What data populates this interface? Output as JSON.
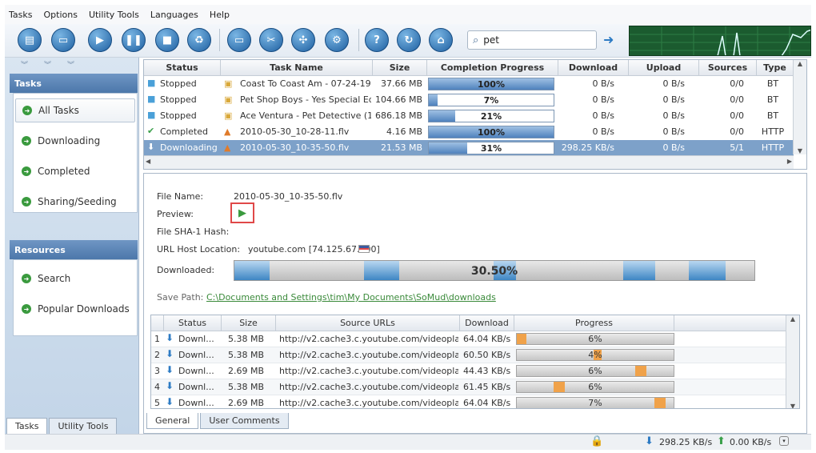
{
  "menu": [
    "Tasks",
    "Options",
    "Utility Tools",
    "Languages",
    "Help"
  ],
  "search": {
    "value": "pet"
  },
  "sidebar": {
    "tasks_header": "Tasks",
    "task_items": [
      "All Tasks",
      "Downloading",
      "Completed",
      "Sharing/Seeding"
    ],
    "resources_header": "Resources",
    "resource_items": [
      "Search",
      "Popular Downloads"
    ],
    "tabs": [
      "Tasks",
      "Utility Tools"
    ]
  },
  "task_table": {
    "columns": [
      "Status",
      "Task Name",
      "Size",
      "Completion Progress",
      "Download",
      "Upload",
      "Sources",
      "Type"
    ],
    "rows": [
      {
        "status": "Stopped",
        "name": "Coast To Coast Am - 07-24-19...",
        "size": "37.66 MB",
        "progress": "100%",
        "pct": 1.0,
        "down": "0 B/s",
        "up": "0 B/s",
        "sources": "0/0",
        "type": "BT"
      },
      {
        "status": "Stopped",
        "name": "Pet Shop Boys - Yes Special Edi...",
        "size": "104.66 MB",
        "progress": "7%",
        "pct": 0.07,
        "down": "0 B/s",
        "up": "0 B/s",
        "sources": "0/0",
        "type": "BT"
      },
      {
        "status": "Stopped",
        "name": "Ace Ventura - Pet Detective (1...",
        "size": "686.18 MB",
        "progress": "21%",
        "pct": 0.21,
        "down": "0 B/s",
        "up": "0 B/s",
        "sources": "0/0",
        "type": "BT"
      },
      {
        "status": "Completed",
        "name": "2010-05-30_10-28-11.flv",
        "size": "4.16 MB",
        "progress": "100%",
        "pct": 1.0,
        "down": "0 B/s",
        "up": "0 B/s",
        "sources": "0/0",
        "type": "HTTP"
      },
      {
        "status": "Downloading",
        "name": "2010-05-30_10-35-50.flv",
        "size": "21.53 MB",
        "progress": "31%",
        "pct": 0.31,
        "down": "298.25 KB/s",
        "up": "0 B/s",
        "sources": "5/1",
        "type": "HTTP"
      }
    ]
  },
  "details": {
    "file_name_label": "File Name:",
    "file_name": "2010-05-30_10-35-50.flv",
    "preview_label": "Preview:",
    "hash_label": "File SHA-1 Hash:",
    "host_label": "URL Host Location:",
    "host_value": "youtube.com [74.125.67.100]",
    "downloaded_label": "Downloaded:",
    "downloaded_pct": "30.50%",
    "save_path_label": "Save Path:",
    "save_path": "C:\\Documents and Settings\\tim\\My Documents\\SoMud\\downloads"
  },
  "sources_table": {
    "columns": [
      "Status",
      "Size",
      "Source URLs",
      "Download",
      "Progress"
    ],
    "rows": [
      {
        "n": "1",
        "status": "Downl...",
        "size": "5.38 MB",
        "url": "http://v2.cache3.c.youtube.com/videoplayb...",
        "down": "64.04 KB/s",
        "progress": "6%"
      },
      {
        "n": "2",
        "status": "Downl...",
        "size": "5.38 MB",
        "url": "http://v2.cache3.c.youtube.com/videoplayb...",
        "down": "60.50 KB/s",
        "progress": "4%"
      },
      {
        "n": "3",
        "status": "Downl...",
        "size": "2.69 MB",
        "url": "http://v2.cache3.c.youtube.com/videoplayb...",
        "down": "44.43 KB/s",
        "progress": "6%"
      },
      {
        "n": "4",
        "status": "Downl...",
        "size": "5.38 MB",
        "url": "http://v2.cache3.c.youtube.com/videoplayb...",
        "down": "61.45 KB/s",
        "progress": "6%"
      },
      {
        "n": "5",
        "status": "Downl...",
        "size": "2.69 MB",
        "url": "http://v2.cache3.c.youtube.com/videoplayb...",
        "down": "64.04 KB/s",
        "progress": "7%"
      }
    ]
  },
  "detail_tabs": [
    "General",
    "User Comments"
  ],
  "statusbar": {
    "download": "298.25 KB/s",
    "upload": "0.00 KB/s"
  }
}
